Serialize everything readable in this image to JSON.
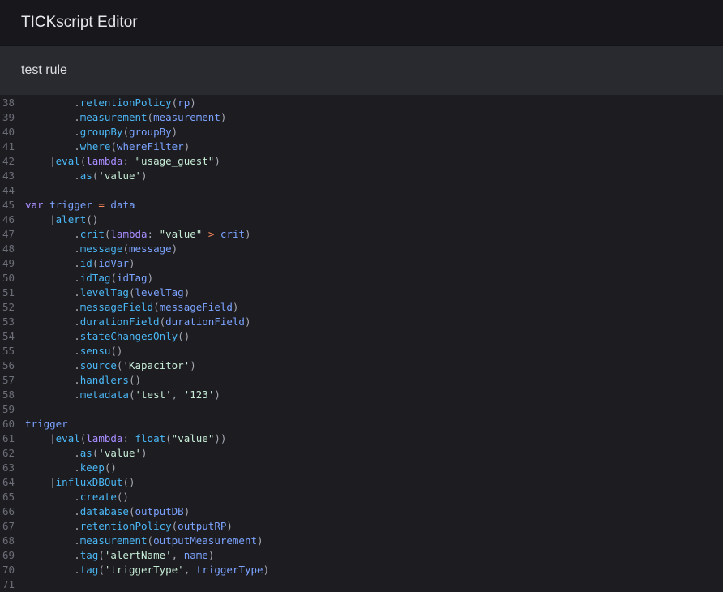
{
  "header": {
    "title": "TICKscript Editor"
  },
  "rule": {
    "name": "test rule"
  },
  "code_lines": [
    {
      "n": "38",
      "tokens": [
        [
          "plain",
          "        "
        ],
        [
          "pun",
          "."
        ],
        [
          "fn",
          "retentionPolicy"
        ],
        [
          "pun",
          "("
        ],
        [
          "var",
          "rp"
        ],
        [
          "pun",
          ")"
        ]
      ]
    },
    {
      "n": "39",
      "tokens": [
        [
          "plain",
          "        "
        ],
        [
          "pun",
          "."
        ],
        [
          "fn",
          "measurement"
        ],
        [
          "pun",
          "("
        ],
        [
          "var",
          "measurement"
        ],
        [
          "pun",
          ")"
        ]
      ]
    },
    {
      "n": "40",
      "tokens": [
        [
          "plain",
          "        "
        ],
        [
          "pun",
          "."
        ],
        [
          "fn",
          "groupBy"
        ],
        [
          "pun",
          "("
        ],
        [
          "var",
          "groupBy"
        ],
        [
          "pun",
          ")"
        ]
      ]
    },
    {
      "n": "41",
      "tokens": [
        [
          "plain",
          "        "
        ],
        [
          "pun",
          "."
        ],
        [
          "fn",
          "where"
        ],
        [
          "pun",
          "("
        ],
        [
          "var",
          "whereFilter"
        ],
        [
          "pun",
          ")"
        ]
      ]
    },
    {
      "n": "42",
      "tokens": [
        [
          "plain",
          "    "
        ],
        [
          "pipe",
          "|"
        ],
        [
          "fn",
          "eval"
        ],
        [
          "pun",
          "("
        ],
        [
          "kw",
          "lambda"
        ],
        [
          "pun",
          ": "
        ],
        [
          "str",
          "\"usage_guest\""
        ],
        [
          "pun",
          ")"
        ]
      ]
    },
    {
      "n": "43",
      "tokens": [
        [
          "plain",
          "        "
        ],
        [
          "pun",
          "."
        ],
        [
          "fn",
          "as"
        ],
        [
          "pun",
          "("
        ],
        [
          "str",
          "'value'"
        ],
        [
          "pun",
          ")"
        ]
      ]
    },
    {
      "n": "44",
      "tokens": []
    },
    {
      "n": "45",
      "tokens": [
        [
          "kw",
          "var"
        ],
        [
          "plain",
          " "
        ],
        [
          "var",
          "trigger"
        ],
        [
          "plain",
          " "
        ],
        [
          "op",
          "="
        ],
        [
          "plain",
          " "
        ],
        [
          "var",
          "data"
        ]
      ]
    },
    {
      "n": "46",
      "tokens": [
        [
          "plain",
          "    "
        ],
        [
          "pipe",
          "|"
        ],
        [
          "fn",
          "alert"
        ],
        [
          "pun",
          "()"
        ]
      ]
    },
    {
      "n": "47",
      "tokens": [
        [
          "plain",
          "        "
        ],
        [
          "pun",
          "."
        ],
        [
          "fn",
          "crit"
        ],
        [
          "pun",
          "("
        ],
        [
          "kw",
          "lambda"
        ],
        [
          "pun",
          ": "
        ],
        [
          "str",
          "\"value\""
        ],
        [
          "plain",
          " "
        ],
        [
          "op",
          ">"
        ],
        [
          "plain",
          " "
        ],
        [
          "var",
          "crit"
        ],
        [
          "pun",
          ")"
        ]
      ]
    },
    {
      "n": "48",
      "tokens": [
        [
          "plain",
          "        "
        ],
        [
          "pun",
          "."
        ],
        [
          "fn",
          "message"
        ],
        [
          "pun",
          "("
        ],
        [
          "var",
          "message"
        ],
        [
          "pun",
          ")"
        ]
      ]
    },
    {
      "n": "49",
      "tokens": [
        [
          "plain",
          "        "
        ],
        [
          "pun",
          "."
        ],
        [
          "fn",
          "id"
        ],
        [
          "pun",
          "("
        ],
        [
          "var",
          "idVar"
        ],
        [
          "pun",
          ")"
        ]
      ]
    },
    {
      "n": "50",
      "tokens": [
        [
          "plain",
          "        "
        ],
        [
          "pun",
          "."
        ],
        [
          "fn",
          "idTag"
        ],
        [
          "pun",
          "("
        ],
        [
          "var",
          "idTag"
        ],
        [
          "pun",
          ")"
        ]
      ]
    },
    {
      "n": "51",
      "tokens": [
        [
          "plain",
          "        "
        ],
        [
          "pun",
          "."
        ],
        [
          "fn",
          "levelTag"
        ],
        [
          "pun",
          "("
        ],
        [
          "var",
          "levelTag"
        ],
        [
          "pun",
          ")"
        ]
      ]
    },
    {
      "n": "52",
      "tokens": [
        [
          "plain",
          "        "
        ],
        [
          "pun",
          "."
        ],
        [
          "fn",
          "messageField"
        ],
        [
          "pun",
          "("
        ],
        [
          "var",
          "messageField"
        ],
        [
          "pun",
          ")"
        ]
      ]
    },
    {
      "n": "53",
      "tokens": [
        [
          "plain",
          "        "
        ],
        [
          "pun",
          "."
        ],
        [
          "fn",
          "durationField"
        ],
        [
          "pun",
          "("
        ],
        [
          "var",
          "durationField"
        ],
        [
          "pun",
          ")"
        ]
      ]
    },
    {
      "n": "54",
      "tokens": [
        [
          "plain",
          "        "
        ],
        [
          "pun",
          "."
        ],
        [
          "fn",
          "stateChangesOnly"
        ],
        [
          "pun",
          "()"
        ]
      ]
    },
    {
      "n": "55",
      "tokens": [
        [
          "plain",
          "        "
        ],
        [
          "pun",
          "."
        ],
        [
          "fn",
          "sensu"
        ],
        [
          "pun",
          "()"
        ]
      ]
    },
    {
      "n": "56",
      "tokens": [
        [
          "plain",
          "        "
        ],
        [
          "pun",
          "."
        ],
        [
          "fn",
          "source"
        ],
        [
          "pun",
          "("
        ],
        [
          "str",
          "'Kapacitor'"
        ],
        [
          "pun",
          ")"
        ]
      ]
    },
    {
      "n": "57",
      "tokens": [
        [
          "plain",
          "        "
        ],
        [
          "pun",
          "."
        ],
        [
          "fn",
          "handlers"
        ],
        [
          "pun",
          "()"
        ]
      ]
    },
    {
      "n": "58",
      "tokens": [
        [
          "plain",
          "        "
        ],
        [
          "pun",
          "."
        ],
        [
          "fn",
          "metadata"
        ],
        [
          "pun",
          "("
        ],
        [
          "str",
          "'test'"
        ],
        [
          "pun",
          ", "
        ],
        [
          "str",
          "'123'"
        ],
        [
          "pun",
          ")"
        ]
      ]
    },
    {
      "n": "59",
      "tokens": []
    },
    {
      "n": "60",
      "tokens": [
        [
          "var",
          "trigger"
        ]
      ]
    },
    {
      "n": "61",
      "tokens": [
        [
          "plain",
          "    "
        ],
        [
          "pipe",
          "|"
        ],
        [
          "fn",
          "eval"
        ],
        [
          "pun",
          "("
        ],
        [
          "kw",
          "lambda"
        ],
        [
          "pun",
          ": "
        ],
        [
          "fn",
          "float"
        ],
        [
          "pun",
          "("
        ],
        [
          "str",
          "\"value\""
        ],
        [
          "pun",
          "))"
        ]
      ]
    },
    {
      "n": "62",
      "tokens": [
        [
          "plain",
          "        "
        ],
        [
          "pun",
          "."
        ],
        [
          "fn",
          "as"
        ],
        [
          "pun",
          "("
        ],
        [
          "str",
          "'value'"
        ],
        [
          "pun",
          ")"
        ]
      ]
    },
    {
      "n": "63",
      "tokens": [
        [
          "plain",
          "        "
        ],
        [
          "pun",
          "."
        ],
        [
          "fn",
          "keep"
        ],
        [
          "pun",
          "()"
        ]
      ]
    },
    {
      "n": "64",
      "tokens": [
        [
          "plain",
          "    "
        ],
        [
          "pipe",
          "|"
        ],
        [
          "fn",
          "influxDBOut"
        ],
        [
          "pun",
          "()"
        ]
      ]
    },
    {
      "n": "65",
      "tokens": [
        [
          "plain",
          "        "
        ],
        [
          "pun",
          "."
        ],
        [
          "fn",
          "create"
        ],
        [
          "pun",
          "()"
        ]
      ]
    },
    {
      "n": "66",
      "tokens": [
        [
          "plain",
          "        "
        ],
        [
          "pun",
          "."
        ],
        [
          "fn",
          "database"
        ],
        [
          "pun",
          "("
        ],
        [
          "var",
          "outputDB"
        ],
        [
          "pun",
          ")"
        ]
      ]
    },
    {
      "n": "67",
      "tokens": [
        [
          "plain",
          "        "
        ],
        [
          "pun",
          "."
        ],
        [
          "fn",
          "retentionPolicy"
        ],
        [
          "pun",
          "("
        ],
        [
          "var",
          "outputRP"
        ],
        [
          "pun",
          ")"
        ]
      ]
    },
    {
      "n": "68",
      "tokens": [
        [
          "plain",
          "        "
        ],
        [
          "pun",
          "."
        ],
        [
          "fn",
          "measurement"
        ],
        [
          "pun",
          "("
        ],
        [
          "var",
          "outputMeasurement"
        ],
        [
          "pun",
          ")"
        ]
      ]
    },
    {
      "n": "69",
      "tokens": [
        [
          "plain",
          "        "
        ],
        [
          "pun",
          "."
        ],
        [
          "fn",
          "tag"
        ],
        [
          "pun",
          "("
        ],
        [
          "str",
          "'alertName'"
        ],
        [
          "pun",
          ", "
        ],
        [
          "var",
          "name"
        ],
        [
          "pun",
          ")"
        ]
      ]
    },
    {
      "n": "70",
      "tokens": [
        [
          "plain",
          "        "
        ],
        [
          "pun",
          "."
        ],
        [
          "fn",
          "tag"
        ],
        [
          "pun",
          "("
        ],
        [
          "str",
          "'triggerType'"
        ],
        [
          "pun",
          ", "
        ],
        [
          "var",
          "triggerType"
        ],
        [
          "pun",
          ")"
        ]
      ]
    },
    {
      "n": "71",
      "tokens": []
    }
  ]
}
